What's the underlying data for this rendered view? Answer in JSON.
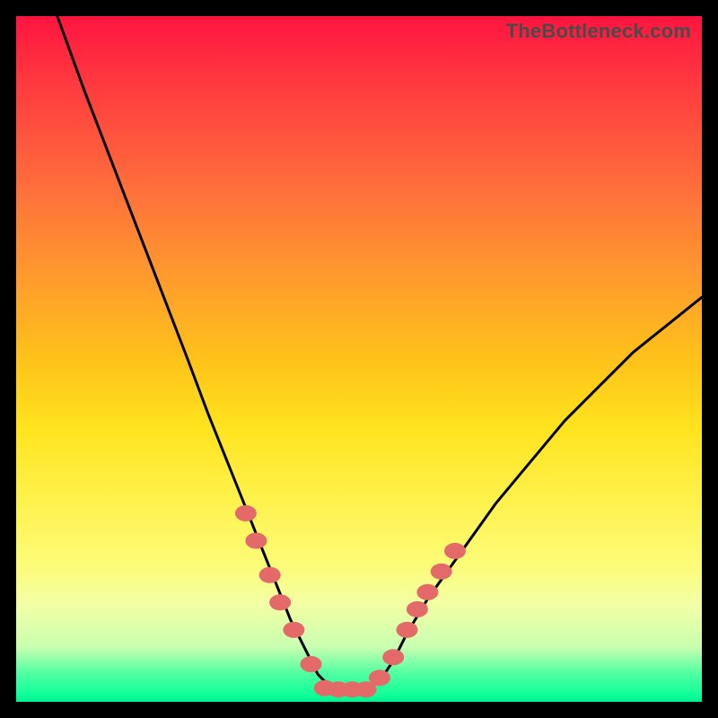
{
  "watermark": "TheBottleneck.com",
  "chart_data": {
    "type": "line",
    "title": "",
    "xlabel": "",
    "ylabel": "",
    "xlim": [
      0,
      100
    ],
    "ylim": [
      0,
      100
    ],
    "series": [
      {
        "name": "bottleneck-curve",
        "x": [
          6,
          10,
          15,
          20,
          25,
          28,
          30,
          32,
          34,
          36,
          38,
          40,
          42,
          44,
          46,
          48,
          50,
          53,
          55,
          57,
          60,
          65,
          70,
          75,
          80,
          85,
          90,
          95,
          100
        ],
        "y": [
          100,
          89,
          76,
          63,
          50,
          42,
          37,
          32,
          27,
          22,
          17,
          12,
          8,
          4,
          2,
          2,
          2,
          3,
          6,
          10,
          15,
          22,
          29,
          35,
          41,
          46,
          51,
          55,
          59
        ]
      }
    ],
    "markers": {
      "name": "highlight-dots",
      "color": "#e46a6a",
      "points": [
        {
          "x": 33.5,
          "y": 27.5
        },
        {
          "x": 35.0,
          "y": 23.5
        },
        {
          "x": 37.0,
          "y": 18.5
        },
        {
          "x": 38.5,
          "y": 14.5
        },
        {
          "x": 40.5,
          "y": 10.5
        },
        {
          "x": 43.0,
          "y": 5.5
        },
        {
          "x": 45.0,
          "y": 2.0
        },
        {
          "x": 47.0,
          "y": 1.8
        },
        {
          "x": 49.0,
          "y": 1.8
        },
        {
          "x": 51.0,
          "y": 1.8
        },
        {
          "x": 53.0,
          "y": 3.5
        },
        {
          "x": 55.0,
          "y": 6.5
        },
        {
          "x": 57.0,
          "y": 10.5
        },
        {
          "x": 58.5,
          "y": 13.5
        },
        {
          "x": 60.0,
          "y": 16.0
        },
        {
          "x": 62.0,
          "y": 19.0
        },
        {
          "x": 64.0,
          "y": 22.0
        }
      ]
    }
  }
}
